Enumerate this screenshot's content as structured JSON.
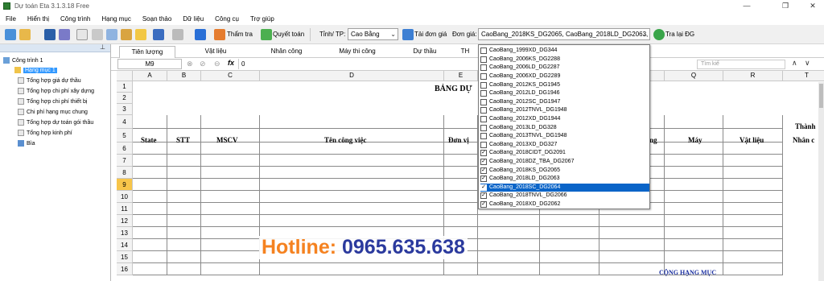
{
  "window": {
    "title": "Dự toán Eta 3.1.3.18 Free"
  },
  "menu": [
    "File",
    "Hiển thị",
    "Công trình",
    "Hạng mục",
    "Soạn thảo",
    "Dữ liệu",
    "Công cụ",
    "Trợ giúp"
  ],
  "toolbar": {
    "thamtra": "Thẩm tra",
    "quyettoan": "Quyết toán",
    "tinhtp_label": "Tỉnh/ TP:",
    "tinhtp_value": "Cao Bằng",
    "taidongia": "Tải đơn giá",
    "dongia_label": "Đơn giá:",
    "dongia_value": "CaoBang_2018KS_DG2065, CaoBang_2018LD_DG2063,",
    "tralai": "Tra lại ĐG"
  },
  "tree": {
    "root": "Công trình 1",
    "items": [
      "Hạng mục 1",
      "Tổng hợp giá dự thầu",
      "Tổng hợp chi phí xây dựng",
      "Tổng hợp chi phí thiết bị",
      "Chi phí hạng mục chung",
      "Tổng hợp dự toán gói thầu",
      "Tổng hợp kinh phí",
      "Bìa"
    ]
  },
  "tabs": [
    "Tiên lượng",
    "Vật liệu",
    "Nhân công",
    "Máy thi công",
    "Dự thầu",
    "TH"
  ],
  "formula": {
    "namebox": "M9",
    "value": "0",
    "fx": "fx",
    "search_placeholder": "Tìm kiế"
  },
  "columns": [
    "A",
    "B",
    "C",
    "D",
    "E",
    "Q",
    "R",
    "T"
  ],
  "rows": [
    "1",
    "2",
    "3",
    "4",
    "5",
    "6",
    "7",
    "8",
    "9",
    "10",
    "11",
    "12",
    "13",
    "14",
    "15",
    "16"
  ],
  "sheet": {
    "title": "BẢNG DỰ",
    "state": "State",
    "stt": "STT",
    "mscv": "MSCV",
    "tencv": "Tên công việc",
    "donvi": "Đơn vị",
    "ng": "ng",
    "may": "Máy",
    "vatlieu": "Vật liệu",
    "nhancong": "Nhân c",
    "thanh": "Thành",
    "cong": "CỘNG HẠNG MỤC"
  },
  "dropdown": [
    {
      "label": "CaoBang_1999XD_DG344",
      "checked": false
    },
    {
      "label": "CaoBang_2006KS_DG2288",
      "checked": false
    },
    {
      "label": "CaoBang_2006LD_DG2287",
      "checked": false
    },
    {
      "label": "CaoBang_2006XD_DG2289",
      "checked": false
    },
    {
      "label": "CaoBang_2012KS_DG1945",
      "checked": false
    },
    {
      "label": "CaoBang_2012LD_DG1946",
      "checked": false
    },
    {
      "label": "CaoBang_2012SC_DG1947",
      "checked": false
    },
    {
      "label": "CaoBang_2012TNVL_DG1948",
      "checked": false
    },
    {
      "label": "CaoBang_2012XD_DG1944",
      "checked": false
    },
    {
      "label": "CaoBang_2013LD_DG328",
      "checked": false
    },
    {
      "label": "CaoBang_2013TNVL_DG1948",
      "checked": false
    },
    {
      "label": "CaoBang_2013XD_DG327",
      "checked": false
    },
    {
      "label": "CaoBang_2018CIDT_DG2091",
      "checked": true
    },
    {
      "label": "CaoBang_2018DZ_TBA_DG2067",
      "checked": true
    },
    {
      "label": "CaoBang_2018KS_DG2065",
      "checked": true
    },
    {
      "label": "CaoBang_2018LD_DG2063",
      "checked": true
    },
    {
      "label": "CaoBang_2018SC_DG2064",
      "checked": true,
      "selected": true
    },
    {
      "label": "CaoBang_2018TNVL_DG2066",
      "checked": true
    },
    {
      "label": "CaoBang_2018XD_DG2062",
      "checked": true
    }
  ],
  "hotline": {
    "label": "Hotline:",
    "number": "0965.635.638"
  },
  "colors": {
    "accent": "#0a64c8",
    "hotline_label": "#f58220",
    "hotline_number": "#2b3a9e",
    "cong": "#1a2fa0"
  }
}
